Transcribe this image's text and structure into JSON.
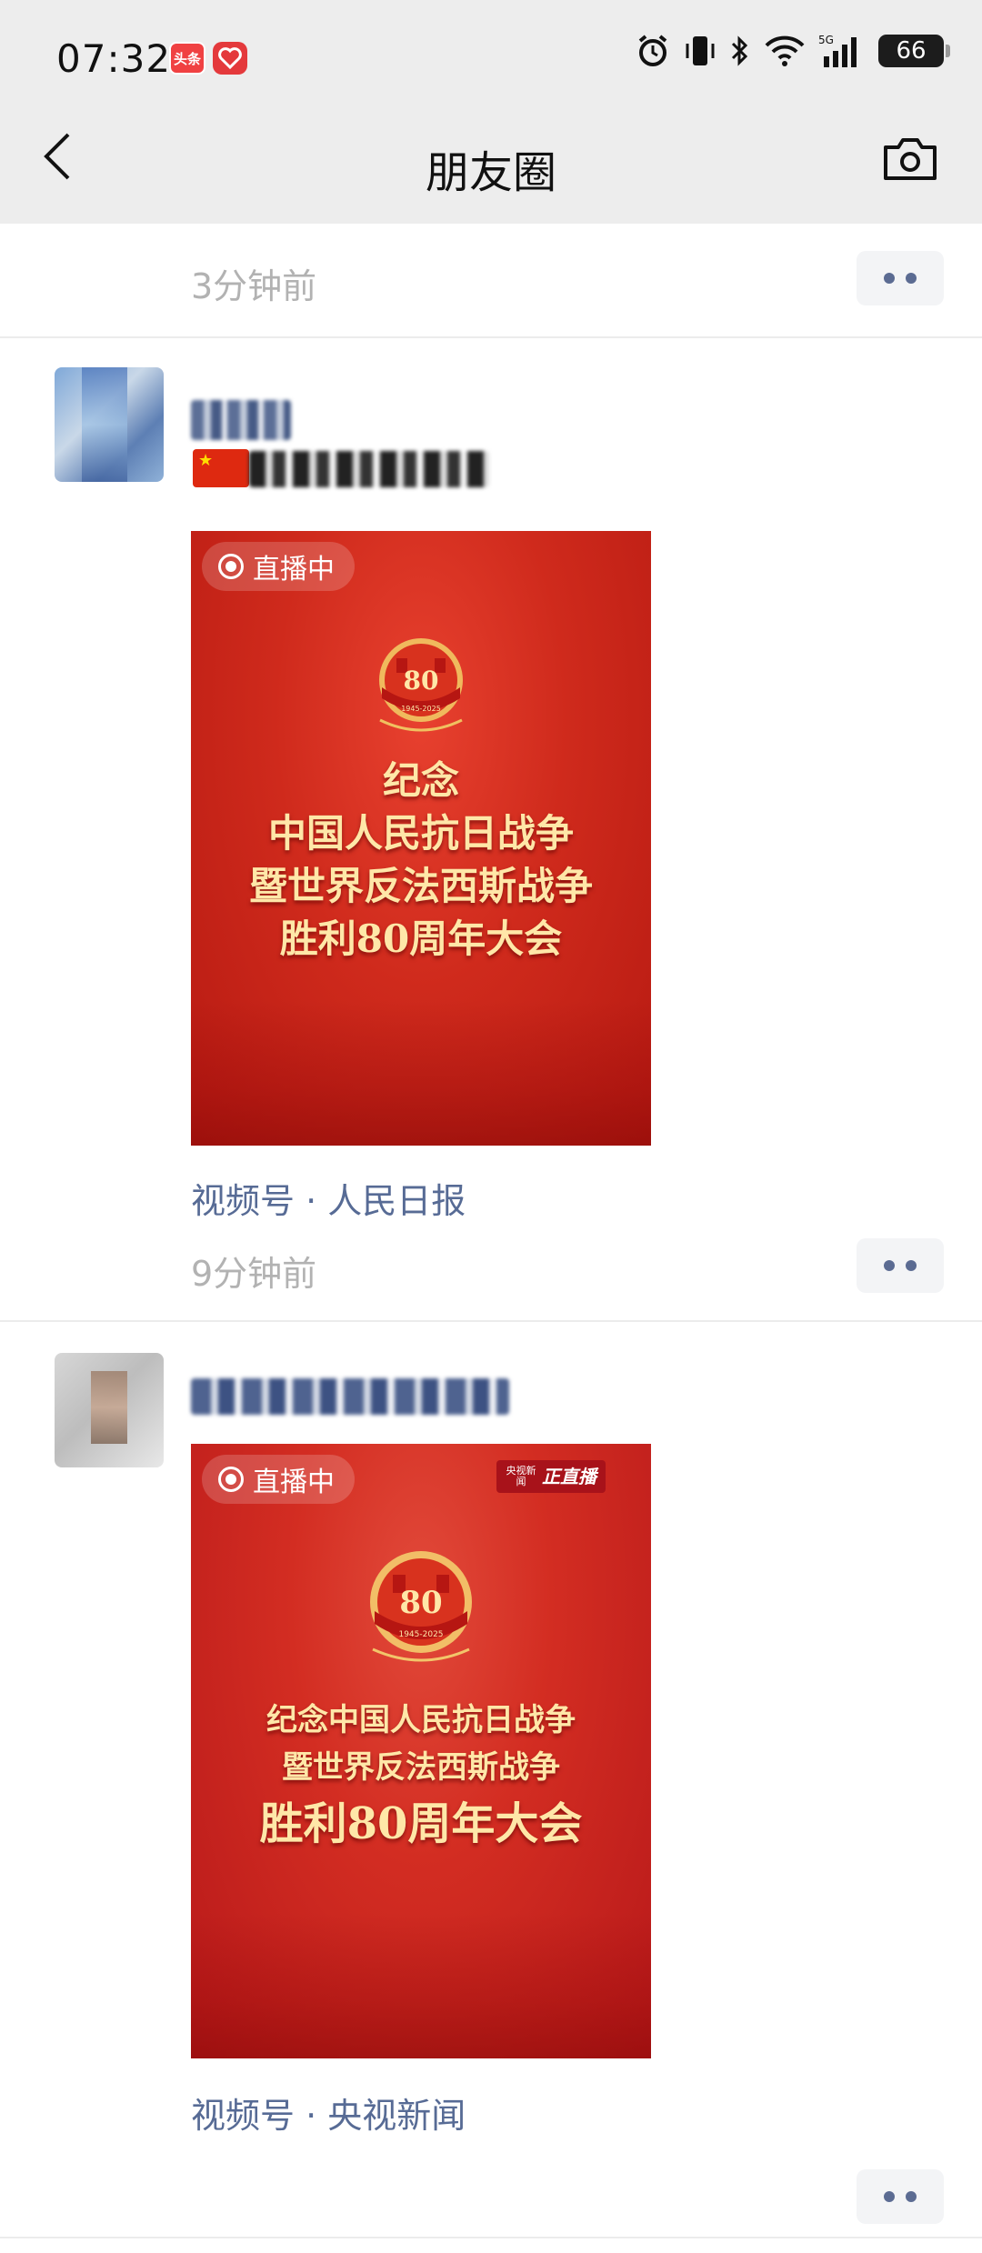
{
  "status_bar": {
    "time": "07:32",
    "badge_toutiao": "头条",
    "battery": "66"
  },
  "header": {
    "title": "朋友圈"
  },
  "posts": [
    {
      "time": "3分钟前"
    },
    {
      "video_live_label": "直播中",
      "video_title_lines": [
        "纪念",
        "中国人民抗日战争",
        "暨世界反法西斯战争",
        "胜利80周年大会"
      ],
      "emblem_number": "80",
      "emblem_years": "1945-2025",
      "source": "视频号 · 人民日报",
      "time": "9分钟前"
    },
    {
      "video_live_label": "直播中",
      "cctv_small": "央视新闻",
      "cctv_big": "正直播",
      "video_title_lines": [
        "纪念中国人民抗日战争",
        "暨世界反法西斯战争",
        "胜利80周年大会"
      ],
      "emblem_number": "80",
      "emblem_years": "1945-2025",
      "source": "视频号 · 央视新闻"
    }
  ],
  "colors": {
    "link": "#576b95",
    "time": "#b2b2b2",
    "header_bg": "#ededed",
    "live_red": "#cf2a1c"
  }
}
